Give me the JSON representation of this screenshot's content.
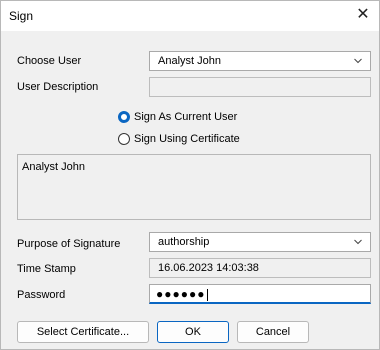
{
  "window": {
    "title": "Sign",
    "close_glyph": "✕"
  },
  "form": {
    "choose_user_label": "Choose User",
    "choose_user_value": "Analyst John",
    "user_description_label": "User Description",
    "user_description_value": "",
    "sign_mode_options": [
      {
        "label": "Sign As Current User",
        "selected": true
      },
      {
        "label": "Sign Using Certificate",
        "selected": false
      }
    ],
    "description_text": "Analyst John",
    "purpose_label": "Purpose of Signature",
    "purpose_value": "authorship",
    "timestamp_label": "Time Stamp",
    "timestamp_value": "16.06.2023 14:03:38",
    "password_label": "Password",
    "password_mask": "●●●●●●"
  },
  "buttons": {
    "select_certificate": "Select Certificate...",
    "ok": "OK",
    "cancel": "Cancel"
  },
  "colors": {
    "accent": "#0a66c2",
    "dialog_bg": "#f0f0f0"
  },
  "icons": {
    "close": "close-icon",
    "dropdown": "chevron-down-icon"
  }
}
